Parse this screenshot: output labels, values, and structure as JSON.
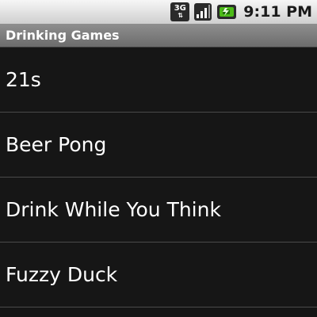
{
  "status_bar": {
    "network_type": "3G",
    "time": "9:11 PM",
    "icons": [
      "network-3g-icon",
      "signal-strength-icon",
      "battery-charging-icon"
    ]
  },
  "app": {
    "title": "Drinking Games"
  },
  "games": [
    {
      "label": "21s"
    },
    {
      "label": "Beer Pong"
    },
    {
      "label": "Drink While You Think"
    },
    {
      "label": "Fuzzy Duck"
    }
  ],
  "colors": {
    "background": "#151515",
    "title_bar": "#7d7d7d",
    "status_bar": "#e2e2e2",
    "battery_accent": "#4cbb17",
    "divider": "#4a4a4a"
  }
}
